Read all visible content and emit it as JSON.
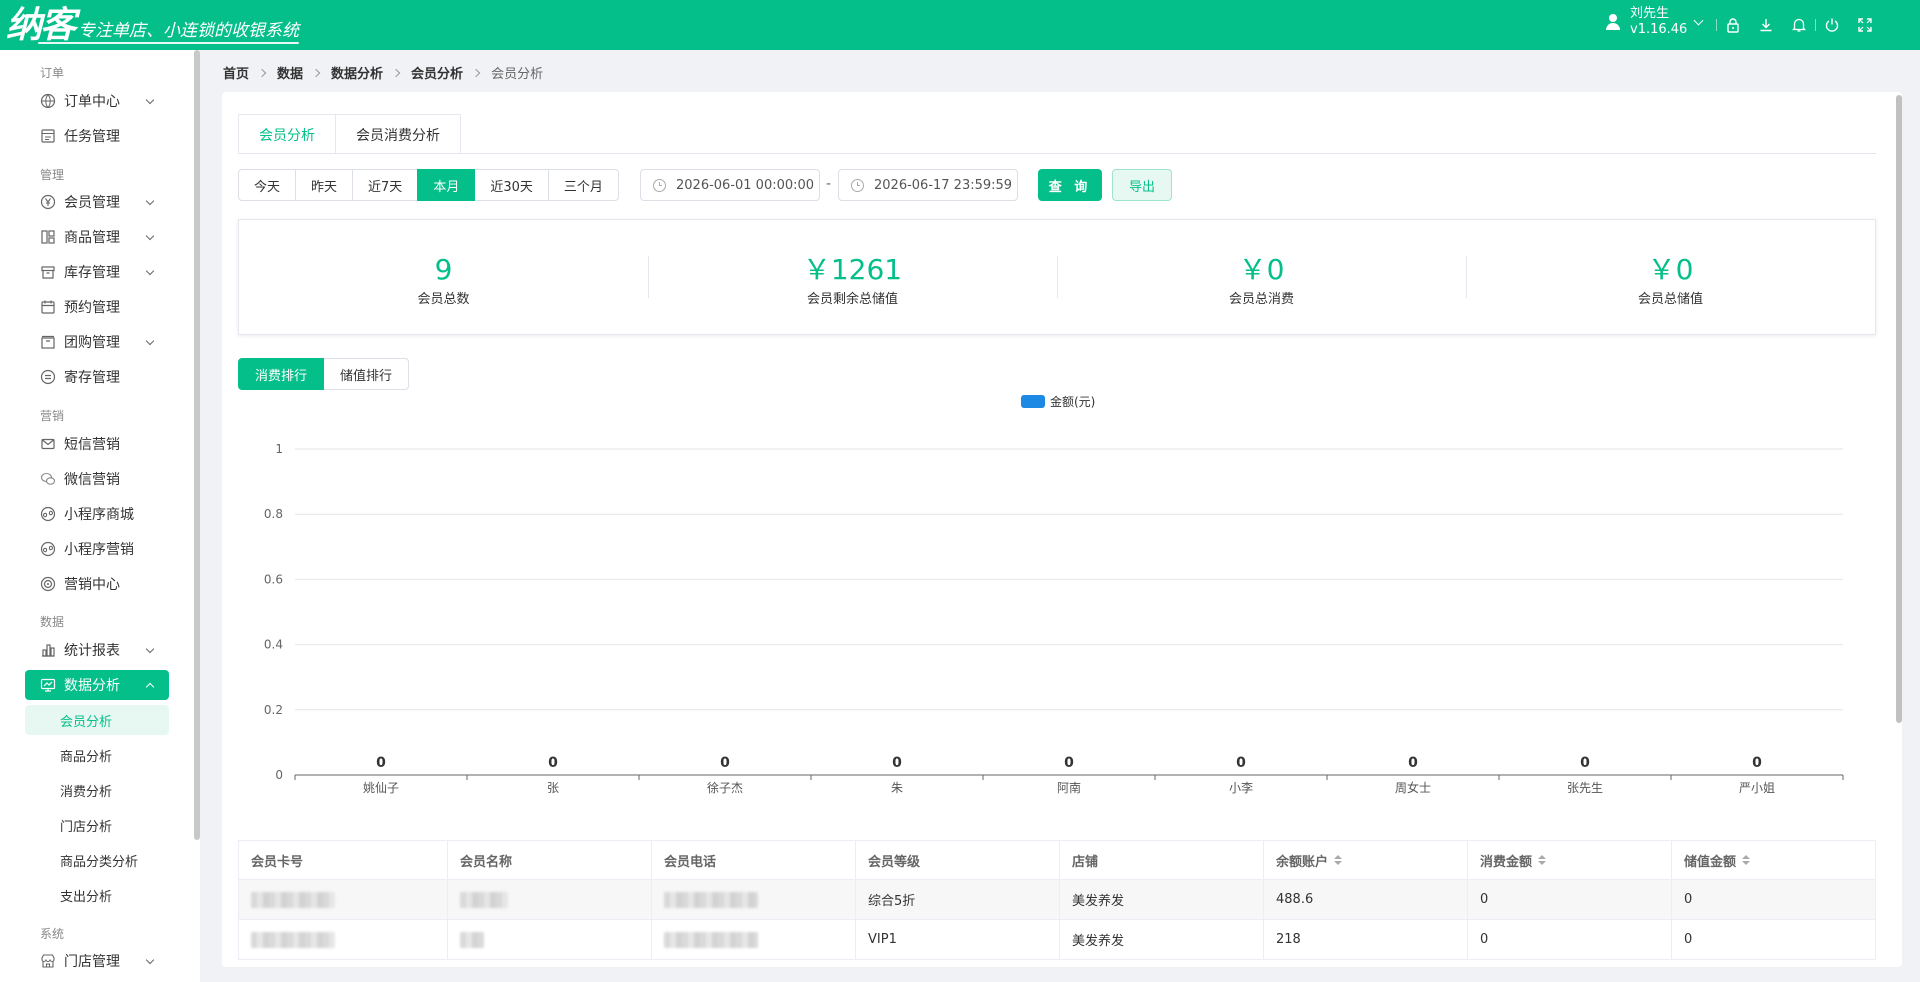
{
  "header": {
    "logo": "纳客",
    "slogan": "专注单店、小连锁的收银系统",
    "user_name": "刘先生",
    "version": "v1.16.46",
    "icons": [
      "lock-icon",
      "download-icon",
      "bell-icon",
      "power-icon",
      "fullscreen-icon"
    ]
  },
  "sidebar": {
    "groups": [
      {
        "title": "订单",
        "items": [
          {
            "label": "订单中心",
            "icon": "globe-icon",
            "has_children": true
          },
          {
            "label": "任务管理",
            "icon": "task-icon",
            "has_children": false
          }
        ]
      },
      {
        "title": "管理",
        "items": [
          {
            "label": "会员管理",
            "icon": "yen-circle-icon",
            "has_children": true
          },
          {
            "label": "商品管理",
            "icon": "goods-icon",
            "has_children": true
          },
          {
            "label": "库存管理",
            "icon": "box-icon",
            "has_children": true
          },
          {
            "label": "预约管理",
            "icon": "calendar-icon",
            "has_children": false
          },
          {
            "label": "团购管理",
            "icon": "bag-icon",
            "has_children": true
          },
          {
            "label": "寄存管理",
            "icon": "storage-icon",
            "has_children": false
          }
        ]
      },
      {
        "title": "营销",
        "items": [
          {
            "label": "短信营销",
            "icon": "mail-icon",
            "has_children": false
          },
          {
            "label": "微信营销",
            "icon": "wechat-icon",
            "has_children": false
          },
          {
            "label": "小程序商城",
            "icon": "miniprogram-icon",
            "has_children": false
          },
          {
            "label": "小程序营销",
            "icon": "miniprogram-icon",
            "has_children": false
          },
          {
            "label": "营销中心",
            "icon": "target-icon",
            "has_children": false
          }
        ]
      },
      {
        "title": "数据",
        "items": [
          {
            "label": "统计报表",
            "icon": "bar-chart-icon",
            "has_children": true
          },
          {
            "label": "数据分析",
            "icon": "monitor-icon",
            "has_children": true,
            "active": true,
            "children": [
              "会员分析",
              "商品分析",
              "消费分析",
              "门店分析",
              "商品分类分析",
              "支出分析"
            ]
          }
        ]
      },
      {
        "title": "系统",
        "items": [
          {
            "label": "门店管理",
            "icon": "store-icon",
            "has_children": true
          }
        ]
      }
    ],
    "active_child": "会员分析"
  },
  "breadcrumb": [
    "首页",
    "数据",
    "数据分析",
    "会员分析",
    "会员分析"
  ],
  "tabs": [
    "会员分析",
    "会员消费分析"
  ],
  "active_tab": "会员分析",
  "filters": {
    "ranges": [
      "今天",
      "昨天",
      "近7天",
      "本月",
      "近30天",
      "三个月"
    ],
    "active_range": "本月",
    "start": "2026-06-01 00:00:00",
    "separator": "-",
    "end": "2026-06-17 23:59:59",
    "query_label": "查 询",
    "export_label": "导出"
  },
  "stats": [
    {
      "value": "9",
      "label": "会员总数"
    },
    {
      "value": "￥1261",
      "label": "会员剩余总储值"
    },
    {
      "value": "￥0",
      "label": "会员总消费"
    },
    {
      "value": "￥0",
      "label": "会员总储值"
    }
  ],
  "rank_tabs": [
    "消费排行",
    "储值排行"
  ],
  "active_rank": "消费排行",
  "colors": {
    "accent": "#05bf8a",
    "bar": "#1e88e5"
  },
  "chart_data": {
    "type": "bar",
    "legend": [
      "金额(元)"
    ],
    "legend_position": "top-center",
    "categories": [
      "姚仙子",
      "张",
      "徐子杰",
      "朱",
      "阿南",
      "小李",
      "周女士",
      "张先生",
      "严小姐"
    ],
    "series": [
      {
        "name": "金额(元)",
        "values": [
          0,
          0,
          0,
          0,
          0,
          0,
          0,
          0,
          0
        ]
      }
    ],
    "yticks": [
      "0",
      "0.2",
      "0.4",
      "0.6",
      "0.8",
      "1"
    ],
    "ylim": [
      0,
      1
    ],
    "grid": true
  },
  "table": {
    "columns": [
      {
        "label": "会员卡号",
        "sortable": false
      },
      {
        "label": "会员名称",
        "sortable": false
      },
      {
        "label": "会员电话",
        "sortable": false
      },
      {
        "label": "会员等级",
        "sortable": false
      },
      {
        "label": "店铺",
        "sortable": false
      },
      {
        "label": "余额账户",
        "sortable": true
      },
      {
        "label": "消费金额",
        "sortable": true
      },
      {
        "label": "储值金额",
        "sortable": true
      }
    ],
    "rows": [
      {
        "level": "综合5折",
        "store": "美发养发",
        "balance": "488.6",
        "consume": "0",
        "recharge": "0"
      },
      {
        "level": "VIP1",
        "store": "美发养发",
        "balance": "218",
        "consume": "0",
        "recharge": "0"
      }
    ]
  }
}
